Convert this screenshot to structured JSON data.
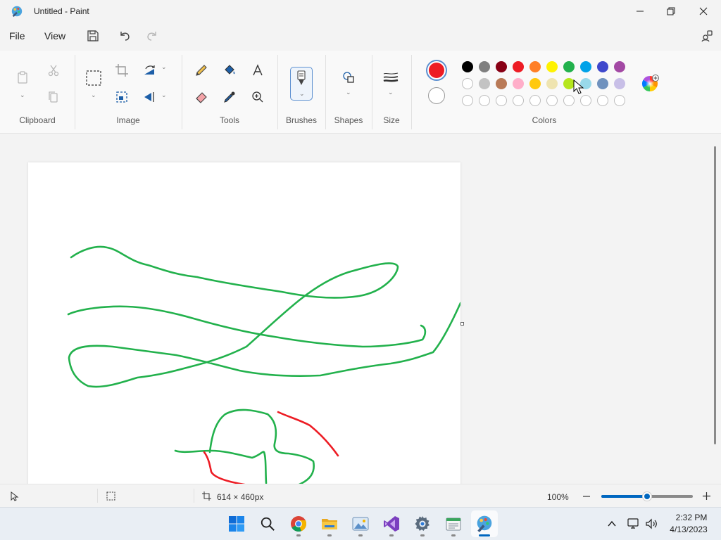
{
  "window": {
    "title": "Untitled - Paint"
  },
  "menu": {
    "file": "File",
    "view": "View"
  },
  "ribbon": {
    "groups": {
      "clipboard": "Clipboard",
      "image": "Image",
      "tools": "Tools",
      "brushes": "Brushes",
      "shapes": "Shapes",
      "size": "Size",
      "colors": "Colors"
    },
    "primary_color": "#ed1c24",
    "secondary_color": "#ffffff",
    "palette": {
      "row1": [
        "#000000",
        "#7f7f7f",
        "#880015",
        "#ed1c24",
        "#ff7f27",
        "#fff200",
        "#22b14c",
        "#00a2e8",
        "#3f48cc",
        "#a349a4"
      ],
      "row2": [
        "#ffffff",
        "#c3c3c3",
        "#b97a57",
        "#ffaec9",
        "#ffc90e",
        "#efe4b0",
        "#b5e61d",
        "#99d9ea",
        "#7092be",
        "#c8bfe7"
      ],
      "row3_empty_count": 10
    }
  },
  "canvas": {
    "stroke_colors": [
      "#22b14c",
      "#ed1c24"
    ]
  },
  "status": {
    "canvas_size": "614 × 460px",
    "zoom": "100%",
    "zoom_level": 0.5
  },
  "taskbar": {
    "time": "2:32 PM",
    "date": "4/13/2023"
  }
}
